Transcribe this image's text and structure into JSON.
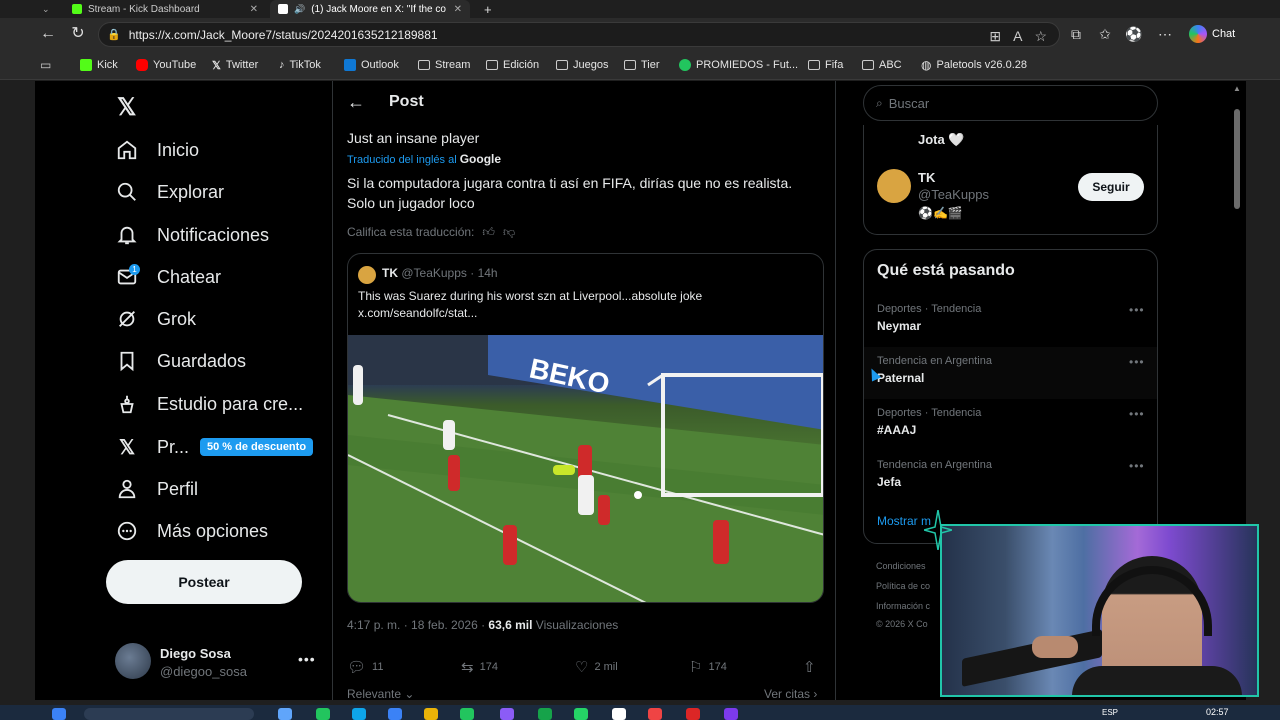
{
  "browser": {
    "tabs": [
      {
        "title": "Stream - Kick Dashboard",
        "favicon_color": "#53fc18"
      },
      {
        "title": "(1) Jack Moore en X: \"If the co",
        "favicon_color": "#ffffff"
      }
    ],
    "url": "https://x.com/Jack_Moore7/status/2024201635212189881",
    "copilot_label": "Chat",
    "bookmarks": [
      {
        "label": "Kick",
        "icon": "kick-icon",
        "color": "#53fc18"
      },
      {
        "label": "YouTube",
        "icon": "youtube-icon",
        "color": "#ff0000"
      },
      {
        "label": "Twitter",
        "icon": "x-logo-icon",
        "color": "#ffffff"
      },
      {
        "label": "TikTok",
        "icon": "tiktok-icon",
        "color": "#ffffff"
      },
      {
        "label": "Outlook",
        "icon": "outlook-icon",
        "color": "#0f78d4"
      },
      {
        "label": "Stream",
        "icon": "folder-icon",
        "color": ""
      },
      {
        "label": "Edición",
        "icon": "folder-icon",
        "color": ""
      },
      {
        "label": "Juegos",
        "icon": "folder-icon",
        "color": ""
      },
      {
        "label": "Tier",
        "icon": "folder-icon",
        "color": ""
      },
      {
        "label": "PROMIEDOS - Fut...",
        "icon": "promiedos-icon",
        "color": "#22c55e"
      },
      {
        "label": "Fifa",
        "icon": "folder-icon",
        "color": ""
      },
      {
        "label": "ABC",
        "icon": "folder-icon",
        "color": ""
      },
      {
        "label": "Paletools v26.0.28",
        "icon": "globe-icon",
        "color": ""
      }
    ]
  },
  "sidebar": {
    "items": [
      {
        "label": "Inicio",
        "icon": "home-icon"
      },
      {
        "label": "Explorar",
        "icon": "search-icon"
      },
      {
        "label": "Notificaciones",
        "icon": "bell-icon"
      },
      {
        "label": "Chatear",
        "icon": "mail-icon",
        "badge": "1"
      },
      {
        "label": "Grok",
        "icon": "grok-icon"
      },
      {
        "label": "Guardados",
        "icon": "bookmark-icon"
      },
      {
        "label": "Estudio para cre...",
        "icon": "creator-studio-icon"
      },
      {
        "label": "Pr...",
        "icon": "x-logo-icon"
      },
      {
        "label": "Perfil",
        "icon": "person-icon"
      },
      {
        "label": "Más opciones",
        "icon": "more-circle-icon"
      }
    ],
    "premium_promo": "50 % de descuento",
    "post_button": "Postear",
    "account": {
      "name": "Diego Sosa",
      "handle": "@diegoo_sosa"
    }
  },
  "post": {
    "header_title": "Post",
    "original_text": "Just an insane player",
    "translated_by_label": "Traducido del inglés al",
    "translator": "Google",
    "translated_text_1": "Si la computadora jugara contra ti así en FIFA, dirías que no es realista.",
    "translated_text_2": "Solo un jugador loco",
    "rate_translation": "Califica esta traducción:",
    "quoted": {
      "name": "TK",
      "handle": "@TeaKupps · 14h",
      "text_1": "This was Suarez during his worst szn at Liverpool...absolute joke",
      "text_2": "x.com/seandolfc/stat...",
      "media_sponsor": "BEKO"
    },
    "meta": {
      "time_date": "4:17 p. m. · 18 feb. 2026 · ",
      "views_count": "63,6 mil",
      "views_label": " Visualizaciones"
    },
    "actions": {
      "replies": "11",
      "reposts": "174",
      "likes": "2 mil",
      "bookmarks": "174"
    },
    "sort_label": "Relevante",
    "view_quotes": "Ver citas"
  },
  "right": {
    "search_placeholder": "Buscar",
    "who_to_follow": [
      {
        "name_line": "Jota 🤍"
      },
      {
        "name": "TK",
        "handle": "@TeaKupps",
        "bio": "⚽✍️🎬",
        "follow_label": "Seguir"
      }
    ],
    "trends_title": "Qué está pasando",
    "trends": [
      {
        "context": "Deportes · Tendencia",
        "topic": "Neymar"
      },
      {
        "context": "Tendencia en Argentina",
        "topic": "Paternal"
      },
      {
        "context": "Deportes · Tendencia",
        "topic": "#AAAJ"
      },
      {
        "context": "Tendencia en Argentina",
        "topic": "Jefa"
      }
    ],
    "show_more": "Mostrar m",
    "footer": [
      "Condiciones",
      "Política de co",
      "Información c",
      "© 2026 X Co"
    ]
  },
  "taskbar": {
    "lang": "ESP",
    "time": "02:57"
  },
  "colors": {
    "accent": "#1d9bf0",
    "background": "#000000",
    "muted": "#71767b",
    "webcam_border": "#21c6a9"
  }
}
